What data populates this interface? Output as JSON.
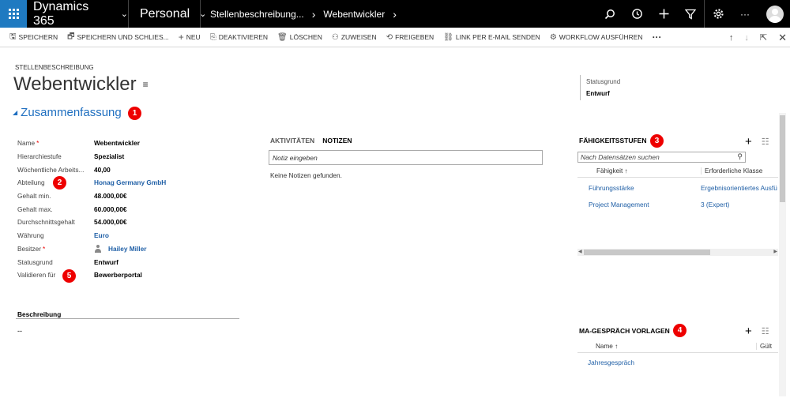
{
  "topnav": {
    "app_name": "Dynamics 365",
    "area": "Personal",
    "breadcrumb": [
      "Stellenbeschreibung...",
      "Webentwickler"
    ]
  },
  "commands": [
    {
      "icon": "save-icon",
      "glyph": "🖫",
      "label": "SPEICHERN"
    },
    {
      "icon": "save-close-icon",
      "glyph": "🗗",
      "label": "SPEICHERN UND SCHLIES..."
    },
    {
      "icon": "plus-icon",
      "glyph": "+",
      "label": "NEU"
    },
    {
      "icon": "deactivate-icon",
      "glyph": "⎘",
      "label": "DEAKTIVIEREN"
    },
    {
      "icon": "trash-icon",
      "glyph": "🗑",
      "label": "LÖSCHEN"
    },
    {
      "icon": "assign-icon",
      "glyph": "⚇",
      "label": "ZUWEISEN"
    },
    {
      "icon": "share-icon",
      "glyph": "⟲",
      "label": "FREIGEBEN"
    },
    {
      "icon": "link-icon",
      "glyph": "⛓",
      "label": "LINK PER E-MAIL SENDEN"
    },
    {
      "icon": "workflow-icon",
      "glyph": "⚙",
      "label": "WORKFLOW AUSFÜHREN"
    }
  ],
  "header": {
    "entity_type": "STELLENBESCHREIBUNG",
    "title": "Webentwickler",
    "status_label": "Statusgrund",
    "status_value": "Entwurf"
  },
  "summary": {
    "section_title": "Zusammenfassung",
    "fields": [
      {
        "label": "Name",
        "value": "Webentwickler",
        "required": true
      },
      {
        "label": "Hierarchiestufe",
        "value": "Spezialist"
      },
      {
        "label": "Wöchentliche Arbeits...",
        "value": "40,00"
      },
      {
        "label": "Abteilung",
        "value": "Honag Germany GmbH",
        "link": true
      },
      {
        "label": "Gehalt min.",
        "value": "48.000,00€"
      },
      {
        "label": "Gehalt max.",
        "value": "60.000,00€"
      },
      {
        "label": "Durchschnittsgehalt",
        "value": "54.000,00€"
      },
      {
        "label": "Währung",
        "value": "Euro",
        "link": true
      },
      {
        "label": "Besitzer",
        "value": "Hailey Miller",
        "link": true,
        "required": true,
        "person": true
      },
      {
        "label": "Statusgrund",
        "value": "Entwurf"
      },
      {
        "label": "Validieren für",
        "value": "Bewerberportal"
      }
    ],
    "description_label": "Beschreibung",
    "description_value": "--"
  },
  "notes": {
    "tab_activities": "AKTIVITÄTEN",
    "tab_notes": "NOTIZEN",
    "input_placeholder": "Notiz eingeben",
    "empty_text": "Keine Notizen gefunden."
  },
  "skills": {
    "title": "FÄHIGKEITSSTUFEN",
    "search_placeholder": "Nach Datensätzen suchen",
    "columns": [
      "Fähigkeit ↑",
      "Erforderliche Klasse"
    ],
    "rows": [
      [
        "Führungsstärke",
        "Ergebnisorientiertes Ausfü"
      ],
      [
        "Project Management",
        "3 (Expert)"
      ]
    ]
  },
  "reviews": {
    "title": "MA-GESPRÄCH VORLAGEN",
    "columns": [
      "Name ↑",
      "Gült"
    ],
    "rows": [
      [
        "Jahresgespräch"
      ]
    ]
  },
  "badges": [
    "1",
    "2",
    "3",
    "4",
    "5"
  ],
  "colors": {
    "accent": "#1f6fc0",
    "waffle": "#1f7ac1",
    "badge": "#e00000"
  }
}
